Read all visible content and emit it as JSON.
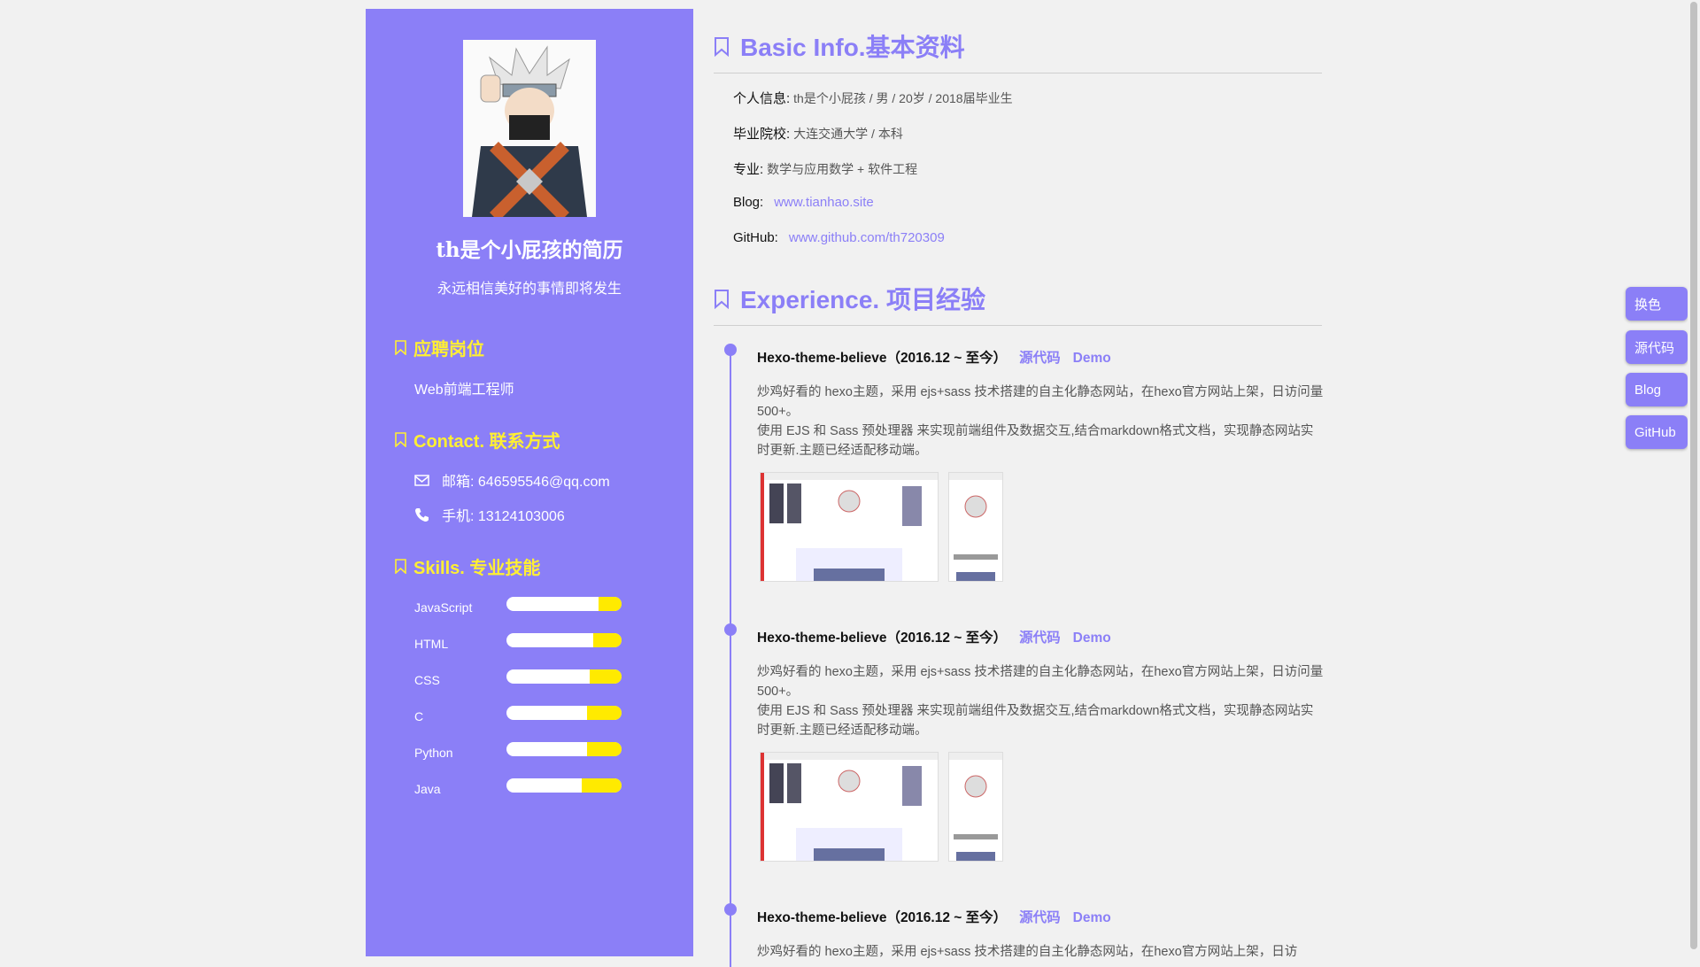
{
  "sidebar": {
    "title": "th是个小屁孩的简历",
    "motto": "永远相信美好的事情即将发生",
    "position_heading": "应聘岗位",
    "position_value": "Web前端工程师",
    "contact_heading": "Contact. 联系方式",
    "email": "邮箱: 646595546@qq.com",
    "phone": "手机: 13124103006",
    "skills_heading": "Skills. 专业技能",
    "skills": [
      {
        "name": "JavaScript",
        "level": 0.8
      },
      {
        "name": "HTML",
        "level": 0.75
      },
      {
        "name": "CSS",
        "level": 0.72
      },
      {
        "name": "C",
        "level": 0.7
      },
      {
        "name": "Python",
        "level": 0.7
      },
      {
        "name": "Java",
        "level": 0.65
      }
    ]
  },
  "basic": {
    "heading": "Basic Info.基本资料",
    "personal_label": "个人信息:",
    "personal_value": "th是个小屁孩 / 男 / 20岁 / 2018届毕业生",
    "school_label": "毕业院校:",
    "school_value": "大连交通大学 / 本科",
    "major_label": "专业:",
    "major_value": "数学与应用数学 + 软件工程",
    "blog_label": "Blog:",
    "blog_link": "www.tianhao.site",
    "github_label": "GitHub:",
    "github_link": "www.github.com/th720309"
  },
  "experience": {
    "heading": "Experience. 项目经验",
    "projects": [
      {
        "title": "Hexo-theme-believe（2016.12 ~ 至今）",
        "source": "源代码",
        "demo": "Demo",
        "desc1": "炒鸡好看的 hexo主题，采用 ejs+sass 技术搭建的自主化静态网站，在hexo官方网站上架，日访问量500+。",
        "desc2": "使用 EJS 和 Sass 预处理器 来实现前端组件及数据交互,结合markdown格式文档，实现静态网站实时更新.主题已经适配移动端。"
      },
      {
        "title": "Hexo-theme-believe（2016.12 ~ 至今）",
        "source": "源代码",
        "demo": "Demo",
        "desc1": "炒鸡好看的 hexo主题，采用 ejs+sass 技术搭建的自主化静态网站，在hexo官方网站上架，日访问量500+。",
        "desc2": "使用 EJS 和 Sass 预处理器 来实现前端组件及数据交互,结合markdown格式文档，实现静态网站实时更新.主题已经适配移动端。"
      },
      {
        "title": "Hexo-theme-believe（2016.12 ~ 至今）",
        "source": "源代码",
        "demo": "Demo",
        "desc1": "炒鸡好看的 hexo主题，采用 ejs+sass 技术搭建的自主化静态网站，在hexo官方网站上架，日访",
        "desc2": ""
      }
    ]
  },
  "float_buttons": [
    "换色",
    "源代码",
    "Blog",
    "GitHub"
  ],
  "colors": {
    "accent": "#8b7ff7",
    "highlight": "#ffef33",
    "bar_fill": "#ffea00"
  }
}
